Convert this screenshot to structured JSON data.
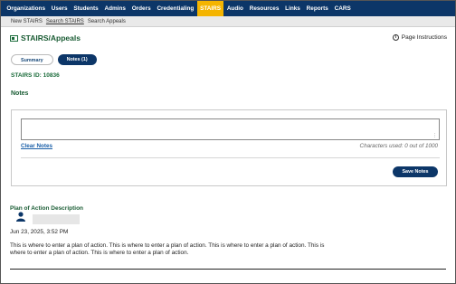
{
  "nav": {
    "items": [
      {
        "label": "Organizations"
      },
      {
        "label": "Users"
      },
      {
        "label": "Students"
      },
      {
        "label": "Admins"
      },
      {
        "label": "Orders"
      },
      {
        "label": "Credentialing"
      },
      {
        "label": "STAIRS"
      },
      {
        "label": "Audio"
      },
      {
        "label": "Resources"
      },
      {
        "label": "Links"
      },
      {
        "label": "Reports"
      },
      {
        "label": "CARS"
      }
    ],
    "active": "STAIRS",
    "accent_color": "#f4b400",
    "bar_color": "#0c3668"
  },
  "subnav": {
    "items": [
      {
        "label": "New STAIRS"
      },
      {
        "label": "Search STAIRS"
      },
      {
        "label": "Search Appeals"
      }
    ]
  },
  "header": {
    "title": "STAIRS/Appeals",
    "instructions_label": "Page Instructions",
    "instructions_icon": "info-icon"
  },
  "tabs": {
    "summary_label": "Summary",
    "notes_label": "Notes (1)"
  },
  "stairs_id": "STAIRS ID: 10836",
  "notes": {
    "section_label": "Notes",
    "input_value": "",
    "clear_label": "Clear Notes",
    "char_count": "Characters used: 0 out of 1000",
    "save_label": "Save Notes"
  },
  "plan": {
    "title": "Plan of Action Description",
    "user_icon": "user-icon",
    "date": "Jun 23, 2025, 3:52 PM",
    "text": "This is where to enter a plan of action. This is where to enter a plan of action. This is where to enter a plan of action. This is where to enter a plan of action. This is where to enter a plan of action."
  }
}
